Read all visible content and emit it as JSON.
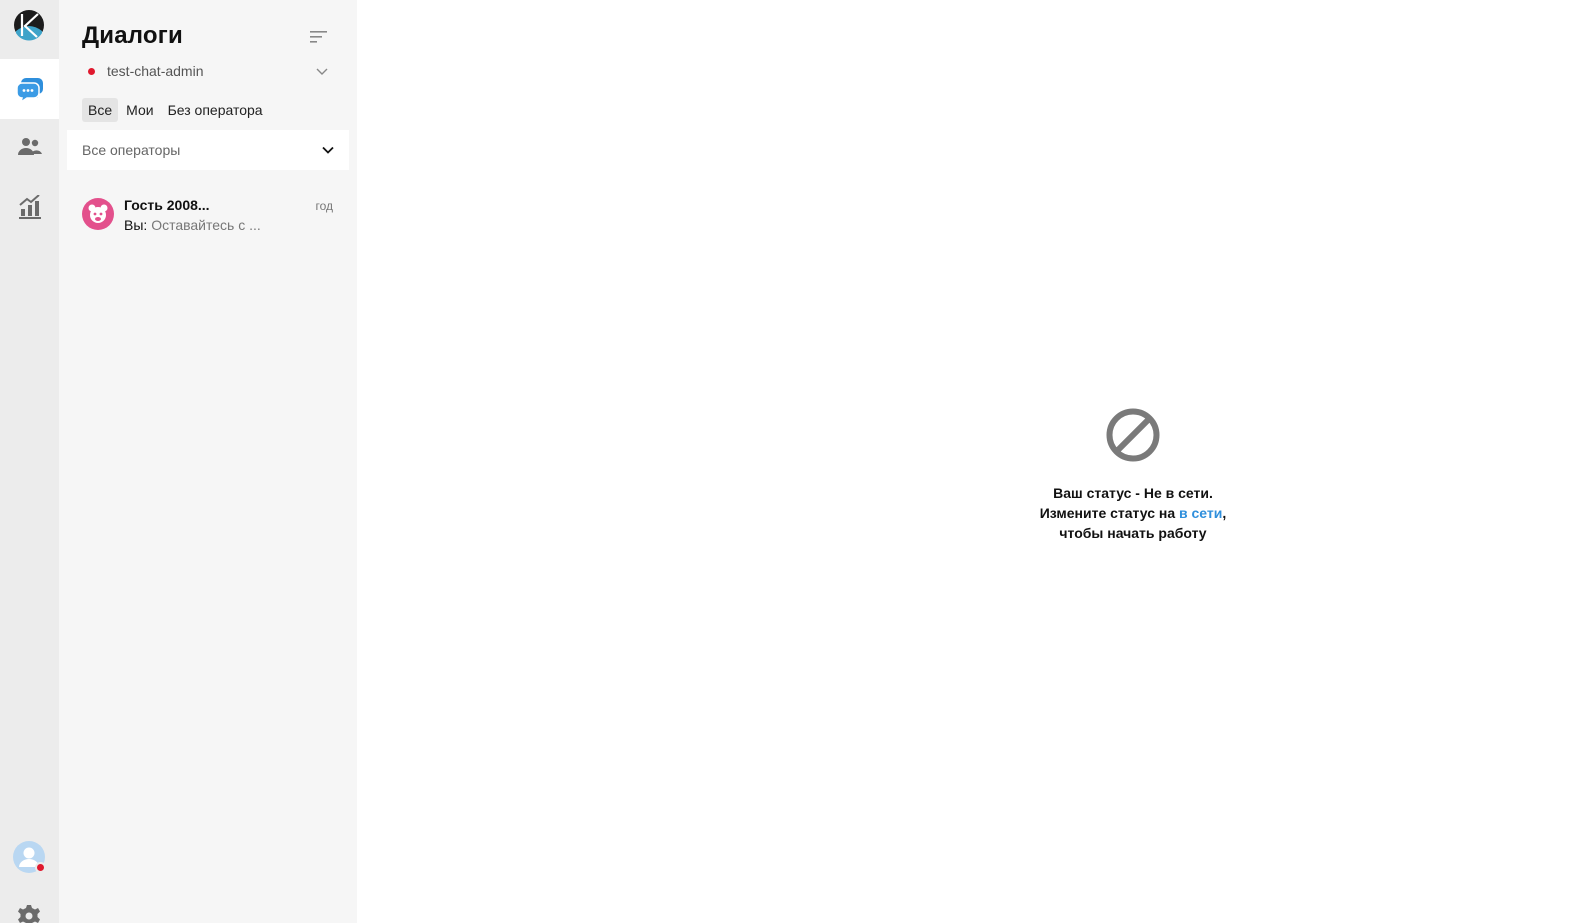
{
  "sidebar_rail": {
    "items": [
      {
        "name": "dialogs",
        "icon": "chat-bubbles-icon",
        "active": true
      },
      {
        "name": "contacts",
        "icon": "users-icon",
        "active": false
      },
      {
        "name": "statistics",
        "icon": "stats-chart-icon",
        "active": false
      }
    ],
    "user_status_color": "#e0192e"
  },
  "dialogs_panel": {
    "title": "Диалоги",
    "account": {
      "name": "test-chat-admin",
      "status_color": "#e0192e"
    },
    "tabs": [
      {
        "label": "Все",
        "active": true
      },
      {
        "label": "Мои",
        "active": false
      },
      {
        "label": "Без оператора",
        "active": false
      }
    ],
    "operator_filter": {
      "selected": "Все операторы"
    },
    "dialogs": [
      {
        "name": "Гость 2008...",
        "time": "год",
        "preview_prefix": "Вы:",
        "preview_text": "Оставайтесь с ..."
      }
    ]
  },
  "main": {
    "offline_line1": "Ваш статус - Не в сети.",
    "offline_line2_prefix": "Измените статус на ",
    "offline_link": "в сети",
    "offline_line2_suffix": ",",
    "offline_line3": "чтобы начать работу"
  },
  "colors": {
    "accent": "#2f8fdc",
    "offline_red": "#e0192e",
    "guest_avatar": "#e3508c",
    "rail_bg": "#ececec",
    "panel_bg": "#f6f6f6"
  }
}
